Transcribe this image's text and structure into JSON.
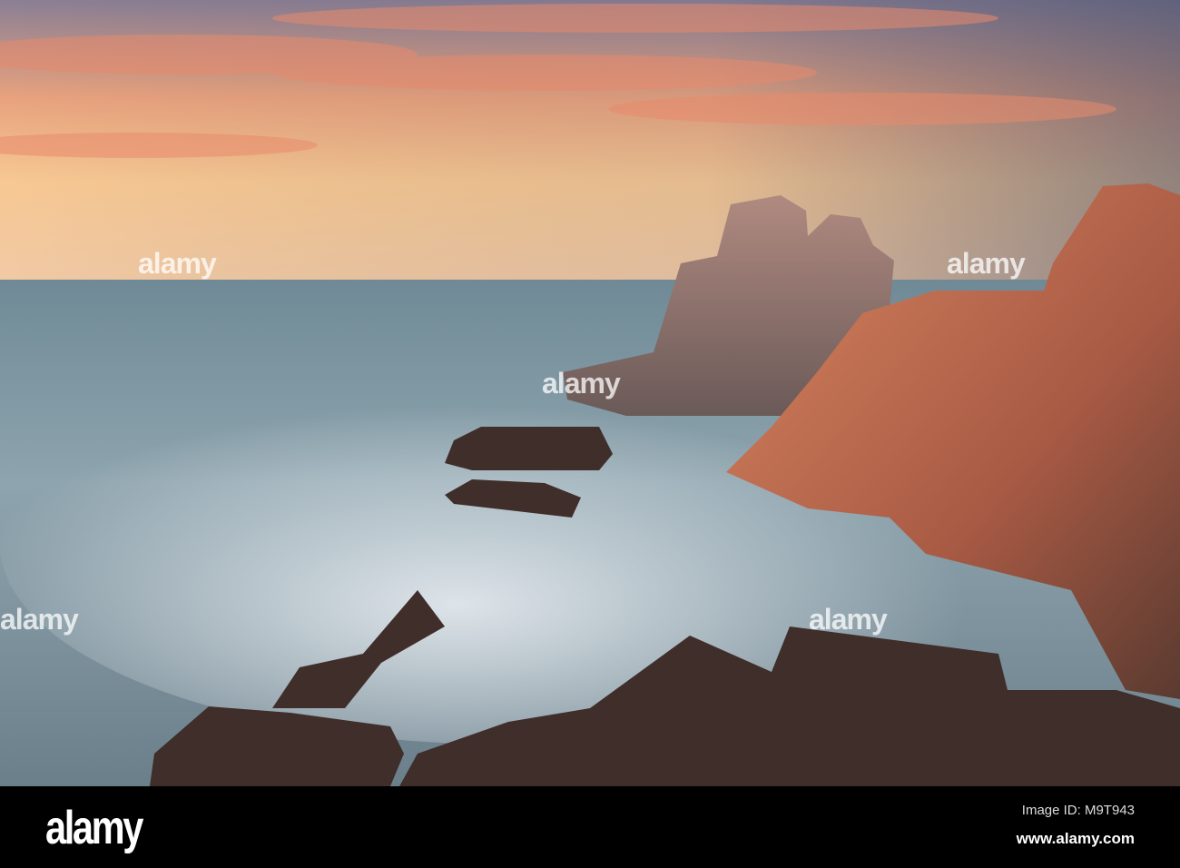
{
  "photo": {
    "subject": "rocky coastline at sunset",
    "colors": {
      "sky_top": "#7a7f9a",
      "sky_glow": "#f6c48a",
      "sea": "#7f98a0",
      "mist": "#dfe6ec",
      "rock_lit": "#c86a4c",
      "rock_dark": "#3a2a26"
    }
  },
  "watermark": {
    "text": "alamy"
  },
  "footer": {
    "logo": "alamy",
    "image_id": "Image ID: M9T943",
    "website": "www.alamy.com"
  }
}
